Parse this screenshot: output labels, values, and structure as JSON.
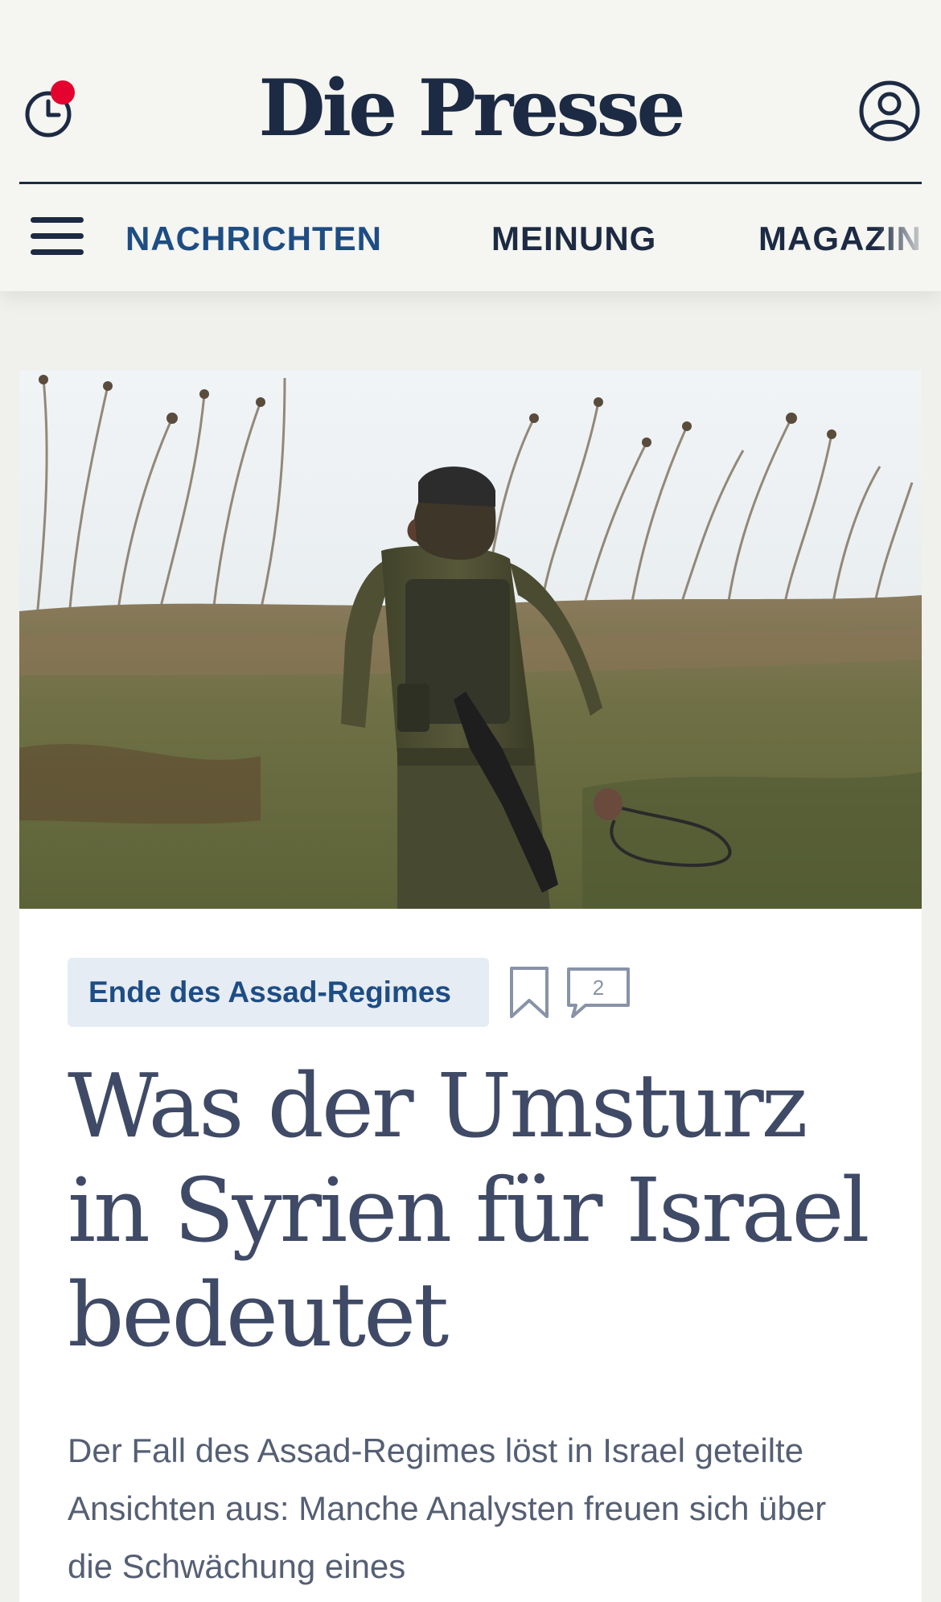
{
  "header": {
    "logo": "Die Presse",
    "history_icon": "clock-history-icon",
    "account_icon": "user-account-icon",
    "notification_color": "#e4032e"
  },
  "nav": {
    "menu_icon": "hamburger-menu-icon",
    "items": [
      {
        "label": "NACHRICHTEN",
        "active": true
      },
      {
        "label": "MEINUNG",
        "active": false
      },
      {
        "label": "MAGAZIN",
        "active": false
      }
    ]
  },
  "article": {
    "image_alt": "Soldat geht über eine Wiese",
    "topic": "Ende des Assad-Regimes",
    "bookmark_icon": "bookmark-icon",
    "comment_icon": "comment-bubble-icon",
    "comment_count": "2",
    "headline": "Was der Umsturz in Syrien für Israel bedeutet",
    "lead": "Der Fall des Assad-Regimes löst in Israel geteilte Ansichten aus: Manche Analysten freuen sich über die Schwächung eines"
  },
  "colors": {
    "brand_navy": "#1c2a43",
    "accent_blue": "#1e4d84",
    "headline": "#3f4a66",
    "tag_bg": "#e6ecf3"
  }
}
